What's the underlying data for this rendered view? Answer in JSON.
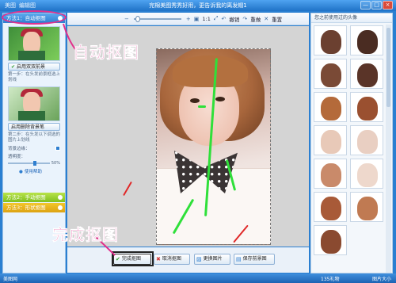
{
  "window": {
    "menu": [
      "美图",
      "编辑图"
    ],
    "title": "完棉美图秀秀好用，更告诉我的离发帽1",
    "controls": [
      "—",
      "□",
      "×"
    ]
  },
  "toolbar": {
    "zoom_out": "−",
    "zoom_in": "+",
    "ratio_label": "1:1",
    "undo_label": "撤销",
    "redo_label": "重做",
    "reset_label": "重置"
  },
  "left_panel": {
    "method1": "方法1：自动抠图",
    "opt1_label": "启用双双前景",
    "desc1": "第一步：在头发前景框选上划线",
    "opt2_label": "启用删除背景笔",
    "desc2": "第二步：在头发以下调选的图片上划线",
    "edge_label": "背景边缘：",
    "opacity_label": "透明度：",
    "slider_value": "50%",
    "help_label": "使用帮助",
    "method2": "方法2：手动抠图",
    "method3": "方法3：形状抠图"
  },
  "right_panel": {
    "header": "您之前使用过的头像"
  },
  "bottom_buttons": {
    "done": "完成抠图",
    "cancel": "取消抠图",
    "change": "更换图片",
    "save": "保存前景图"
  },
  "annotations": {
    "auto": "自动抠图",
    "done": "完成抠图"
  },
  "status": {
    "left": "美图网",
    "mid": "135礼物",
    "right": "图片大小"
  },
  "colors": {
    "frame": "#2a7fd1",
    "annotation": "#e22f8c",
    "stroke_green": "#2fe03a",
    "stroke_red": "#e02828"
  }
}
